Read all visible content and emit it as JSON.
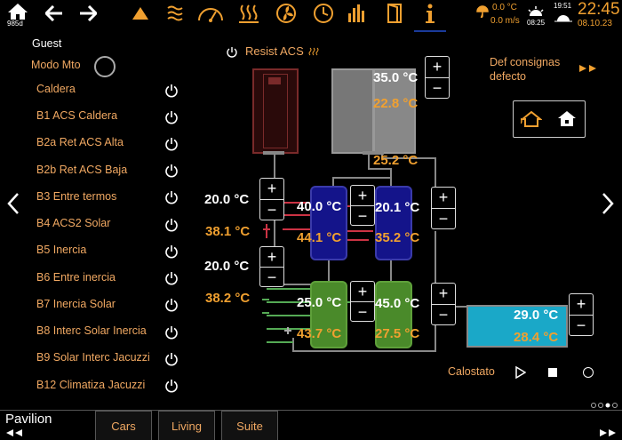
{
  "topbar": {
    "home_badge": "985d",
    "weather": {
      "temperature": "0.0 °C",
      "wind": "0.0 m/s",
      "sunrise": "08:25",
      "sunset": "19:51"
    },
    "clock": {
      "time": "22:45",
      "date": "08.10.23"
    },
    "icons": [
      "home-icon",
      "back-arrow-icon",
      "forward-arrow-icon",
      "warning-triangle-icon",
      "heating-waves-icon",
      "gauge-icon",
      "floor-heating-icon",
      "fan-icon",
      "clock-icon",
      "bar-chart-icon",
      "door-icon",
      "info-icon"
    ]
  },
  "sidebar": {
    "user": "Guest",
    "mode_label": "Modo Mto",
    "items": [
      {
        "label": "Caldera"
      },
      {
        "label": "B1 ACS Caldera"
      },
      {
        "label": "B2a Ret ACS Alta"
      },
      {
        "label": "B2b Ret ACS Baja"
      },
      {
        "label": "B3 Entre termos"
      },
      {
        "label": "B4 ACS2 Solar"
      },
      {
        "label": "B5 Inercia"
      },
      {
        "label": "B6 Entre inercia"
      },
      {
        "label": "B7 Inercia Solar"
      },
      {
        "label": "B8 Interc Solar Inercia"
      },
      {
        "label": "B9 Solar Interc Jacuzzi"
      },
      {
        "label": "B12 Climatiza Jacuzzi"
      }
    ]
  },
  "main": {
    "resist_label": "Resist ACS",
    "def_consignas": "Def consignas defecto",
    "setpoint_1": "20.0 °C",
    "reading_1": "38.1 °C",
    "setpoint_2": "20.0 °C",
    "reading_2": "38.2 °C",
    "acs_tank_top": "35.0 °C",
    "acs_tank_reading": "22.8 °C",
    "pipe_reading": "25.2 °C",
    "blue_left_setpoint": "40.0 °C",
    "blue_left_reading": "44.1 °C",
    "blue_right_setpoint": "20.1 °C",
    "blue_right_reading": "35.2 °C",
    "green_left_setpoint": "25.0 °C",
    "green_left_reading": "43.7 °C",
    "green_right_setpoint": "45.0 °C",
    "green_right_reading": "27.5 °C",
    "pool_setpoint": "29.0 °C",
    "pool_reading": "28.4 °C",
    "calostato_label": "Calostato"
  },
  "tabs": {
    "current": "Pavilion",
    "items": [
      "Cars",
      "Living",
      "Suite"
    ]
  },
  "colors": {
    "accent": "#f0a030",
    "label": "#f0a862",
    "tank_blue": "#1a1a9a",
    "tank_green": "#4e8a2e",
    "tank_red": "#3a1010",
    "pool": "#1aa8c8"
  }
}
